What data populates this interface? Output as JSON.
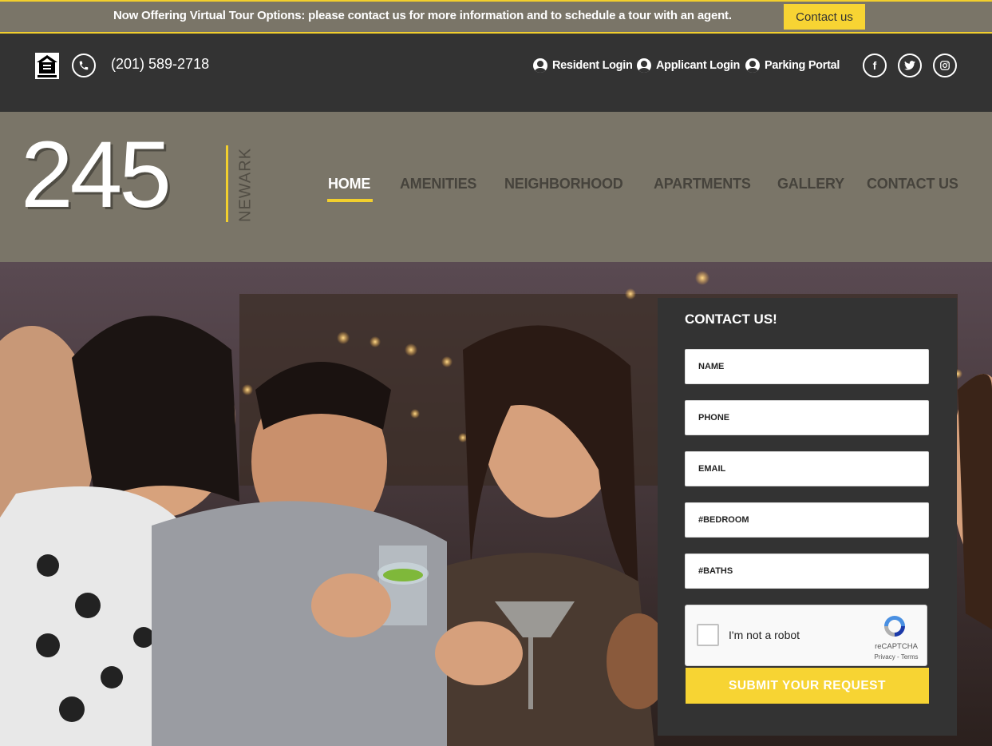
{
  "announcement": {
    "text": "Now Offering Virtual Tour Options: please contact us for more information and to schedule a tour with an agent.",
    "button": "Contact us"
  },
  "utility": {
    "phone": "(201) 589-2718",
    "links": [
      "Resident Login",
      "Applicant Login",
      "Parking Portal"
    ],
    "social_icons": [
      "facebook-icon",
      "twitter-icon",
      "instagram-icon"
    ]
  },
  "logo": {
    "number": "245",
    "sub": "NEWARK"
  },
  "nav": {
    "items": [
      "HOME",
      "AMENITIES",
      "NEIGHBORHOOD",
      "APARTMENTS",
      "GALLERY",
      "CONTACT US"
    ],
    "active": "HOME"
  },
  "contact_form": {
    "title": "CONTACT US!",
    "fields": {
      "name": "NAME",
      "phone": "PHONE",
      "email": "EMAIL",
      "bedroom": "#BEDROOM",
      "baths": "#BATHS"
    },
    "captcha": {
      "label": "I'm not a robot",
      "brand": "reCAPTCHA",
      "links": "Privacy - Terms"
    },
    "submit": "SUBMIT YOUR REQUEST"
  },
  "colors": {
    "accent_yellow": "#f7d433",
    "header_taupe": "#7a7568",
    "dark_bar": "#333333"
  }
}
